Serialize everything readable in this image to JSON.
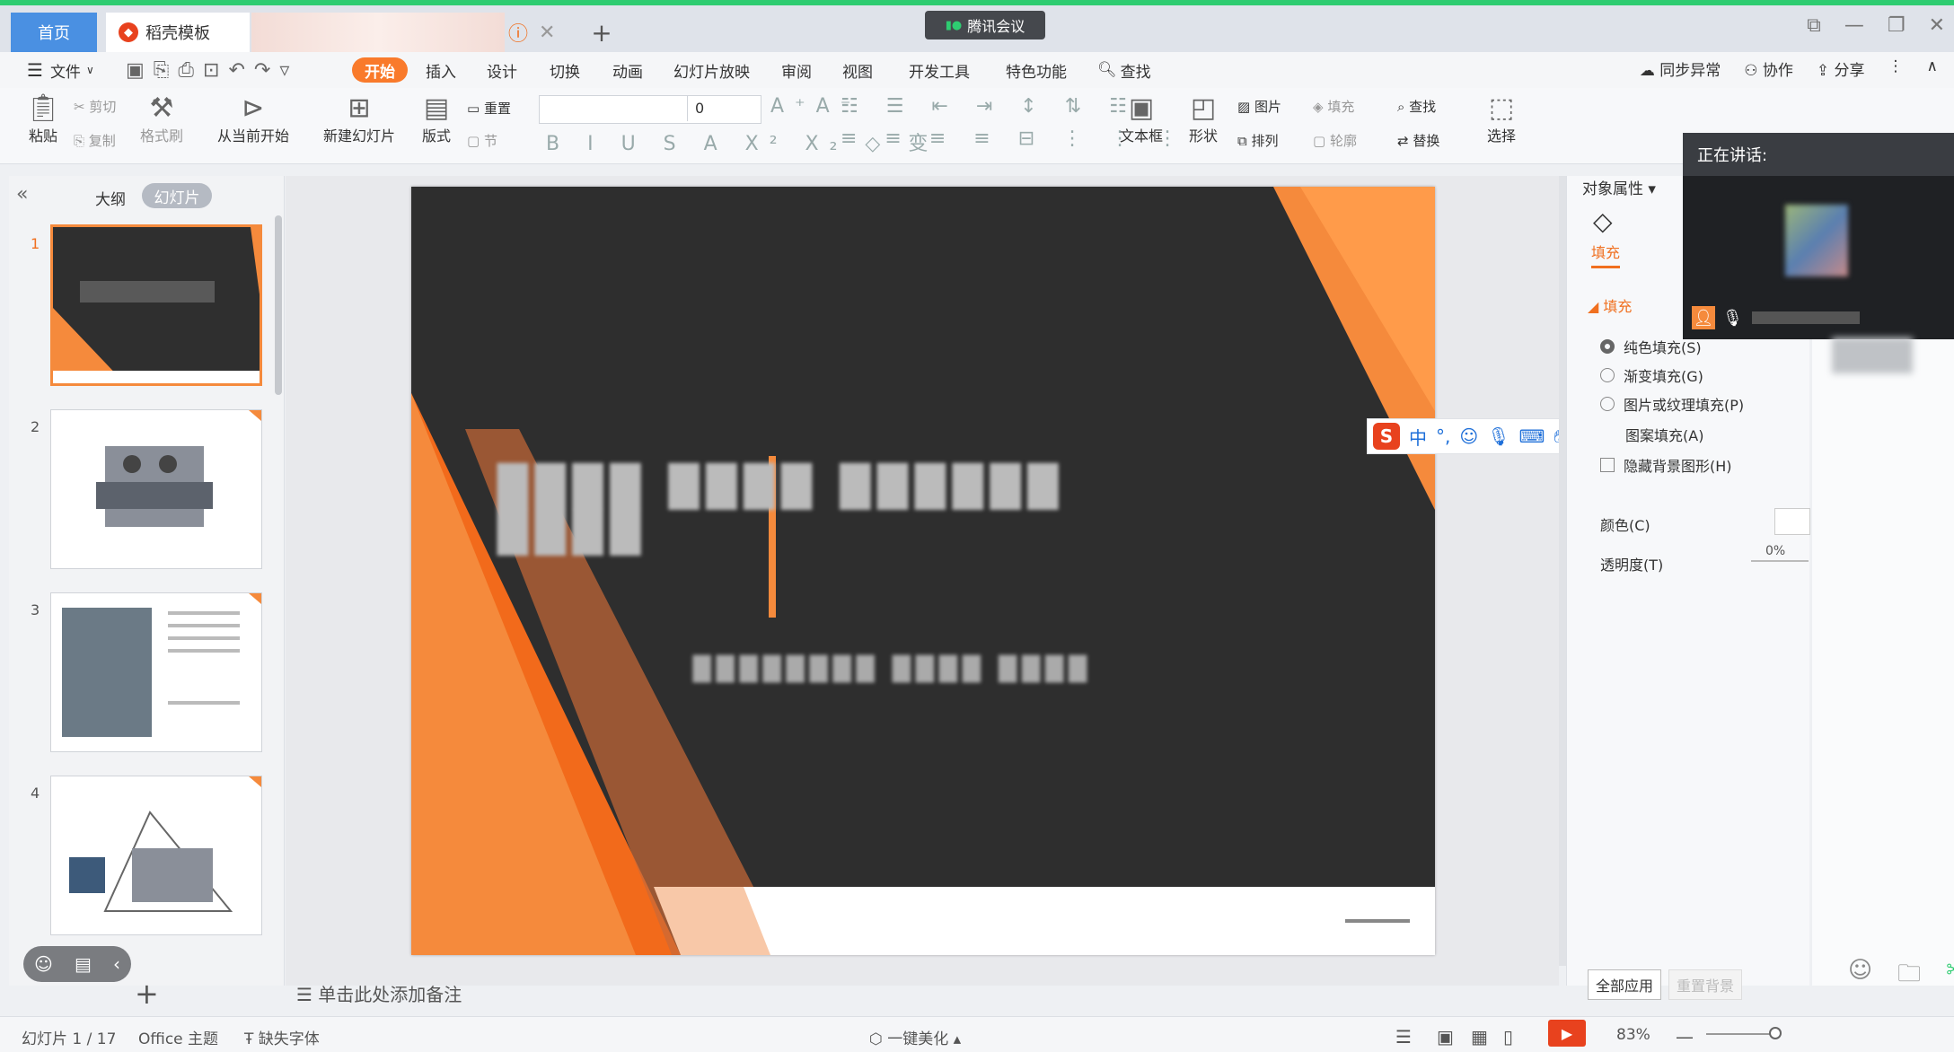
{
  "tabs": {
    "home": "首页",
    "template": "稻壳模板",
    "meeting": "腾讯会议"
  },
  "menu": {
    "file": "文件",
    "items": [
      "开始",
      "插入",
      "设计",
      "切换",
      "动画",
      "幻灯片放映",
      "审阅",
      "视图",
      "开发工具",
      "特色功能"
    ],
    "search": "查找",
    "right": [
      "同步异常",
      "协作",
      "分享"
    ]
  },
  "ribbon": {
    "paste": "粘贴",
    "cut": "剪切",
    "copy": "复制",
    "format_painter": "格式刷",
    "from_current": "从当前开始",
    "new_slide": "新建幻灯片",
    "layout": "版式",
    "reset": "重置",
    "section": "节",
    "font_size_value": "0",
    "textbox": "文本框",
    "shape": "形状",
    "picture": "图片",
    "fill": "填充",
    "arrange": "排列",
    "outline": "轮廓",
    "find": "查找",
    "replace": "替换",
    "select": "选择"
  },
  "left_panel": {
    "outline": "大纲",
    "slides": "幻灯片",
    "numbers": [
      "1",
      "2",
      "3",
      "4"
    ]
  },
  "notes_placeholder": "单击此处添加备注",
  "right_pane": {
    "title": "对象属性",
    "fill_tab": "填充",
    "fill_section": "填充",
    "options": [
      "纯色填充(S)",
      "渐变填充(G)",
      "图片或纹理填充(P)",
      "图案填充(A)"
    ],
    "hide_bg": "隐藏背景图形(H)",
    "color_label": "颜色(C)",
    "transparency_label": "透明度(T)",
    "transparency_value": "0%",
    "apply_all": "全部应用",
    "reset_bg": "重置背景"
  },
  "speaking": {
    "label": "正在讲话:"
  },
  "ime": {
    "lang": "中",
    "punct": "°,"
  },
  "status": {
    "slide_count": "幻灯片 1 / 17",
    "theme": "Office 主题",
    "missing_font": "缺失字体",
    "beautify": "一键美化",
    "zoom": "83%"
  },
  "colors": {
    "accent": "#f97a2b",
    "slide_bg": "#2e2e2e",
    "orange": "#f58a3c"
  }
}
